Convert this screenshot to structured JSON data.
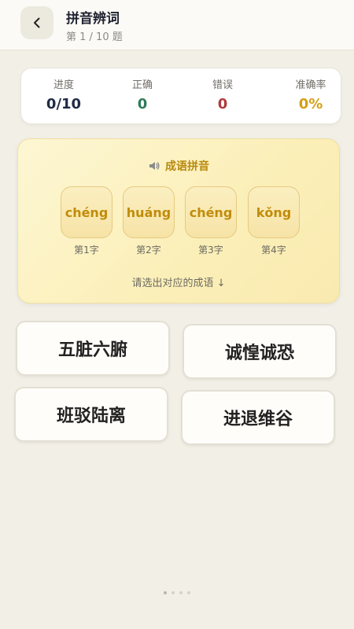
{
  "header": {
    "title": "拼音辨词",
    "subtitle": "第 1 / 10 题"
  },
  "stats": [
    {
      "label": "进度",
      "value": "0/10",
      "color": "#1f2a44"
    },
    {
      "label": "正确",
      "value": "0",
      "color": "#2e7d5b"
    },
    {
      "label": "错误",
      "value": "0",
      "color": "#b23a3a"
    },
    {
      "label": "准确率",
      "value": "0%",
      "color": "#d4a017"
    }
  ],
  "question": {
    "heading": "成语拼音",
    "heading_icon": "speaker-icon",
    "pinyin": [
      {
        "syllable": "chéng",
        "caption": "第1字"
      },
      {
        "syllable": "huáng",
        "caption": "第2字"
      },
      {
        "syllable": "chéng",
        "caption": "第3字"
      },
      {
        "syllable": "kǒng",
        "caption": "第4字"
      }
    ],
    "hint": "请选出对应的成语 ↓"
  },
  "options": [
    "五脏六腑",
    "诚惶诚恐",
    "班驳陆离",
    "进退维谷"
  ],
  "pager": {
    "dots": 4,
    "active_index": 0
  }
}
